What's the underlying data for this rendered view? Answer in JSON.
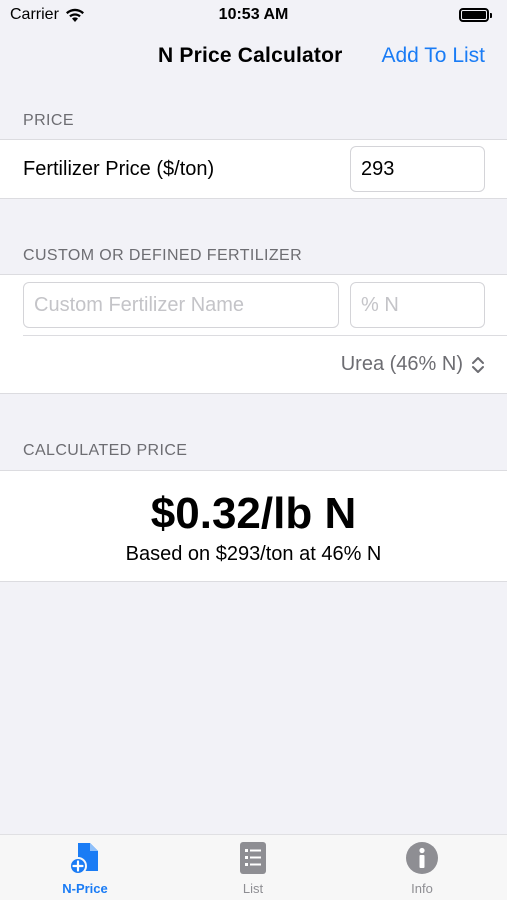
{
  "status": {
    "carrier": "Carrier",
    "time": "10:53 AM"
  },
  "nav": {
    "title": "N Price Calculator",
    "action": "Add To List"
  },
  "price_section": {
    "header": "PRICE",
    "label": "Fertilizer Price ($/ton)",
    "value": "293"
  },
  "fertilizer_section": {
    "header": "CUSTOM OR DEFINED FERTILIZER",
    "name_placeholder": "Custom Fertilizer Name",
    "percent_placeholder": "% N",
    "selected": "Urea (46% N)"
  },
  "calculated_section": {
    "header": "CALCULATED PRICE",
    "price": "$0.32/lb N",
    "detail": "Based on $293/ton at 46% N"
  },
  "tabs": [
    {
      "label": "N-Price",
      "icon": "document-plus-icon",
      "active": true
    },
    {
      "label": "List",
      "icon": "list-icon",
      "active": false
    },
    {
      "label": "Info",
      "icon": "info-icon",
      "active": false
    }
  ],
  "colors": {
    "accent": "#1a7cf5",
    "background": "#f2f2f7",
    "secondary_text": "#6d6d72",
    "inactive_tab": "#8e8e93"
  }
}
